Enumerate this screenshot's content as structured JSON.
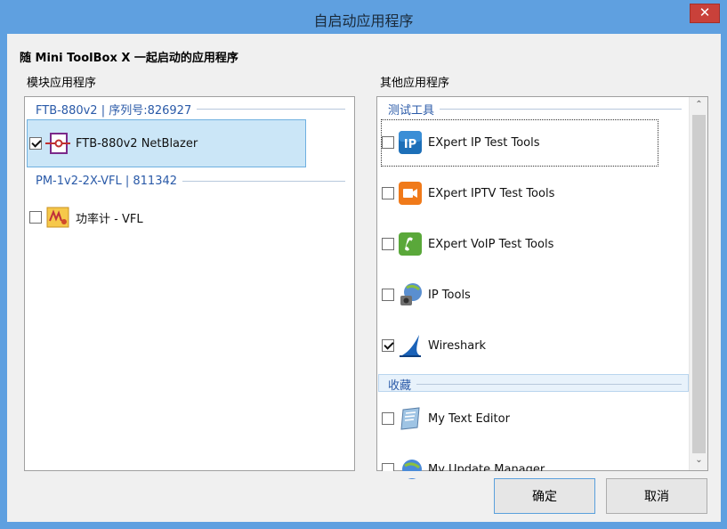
{
  "window": {
    "title": "自启动应用程序",
    "close_glyph": "✕"
  },
  "header_label": "随 Mini ToolBox X 一起启动的应用程序",
  "left": {
    "section_label": "模块应用程序",
    "groups": [
      {
        "header": "FTB-880v2 | 序列号:826927",
        "items": [
          {
            "label": "FTB-880v2 NetBlazer",
            "checked": true,
            "icon": "netblazer-icon"
          }
        ]
      },
      {
        "header": "PM-1v2-2X-VFL | 811342",
        "items": [
          {
            "label": "功率计 - VFL",
            "checked": false,
            "icon": "power-meter-icon"
          }
        ]
      }
    ]
  },
  "right": {
    "section_label": "其他应用程序",
    "groups": [
      {
        "header": "测试工具",
        "items": [
          {
            "label": "EXpert IP Test Tools",
            "checked": false,
            "icon": "expert-ip-icon"
          },
          {
            "label": "EXpert IPTV Test Tools",
            "checked": false,
            "icon": "expert-iptv-icon"
          },
          {
            "label": "EXpert VoIP Test Tools",
            "checked": false,
            "icon": "expert-voip-icon"
          },
          {
            "label": "IP Tools",
            "checked": false,
            "icon": "ip-tools-icon"
          },
          {
            "label": "Wireshark",
            "checked": true,
            "icon": "wireshark-icon"
          }
        ]
      },
      {
        "header": "收藏",
        "items": [
          {
            "label": "My Text Editor",
            "checked": false,
            "icon": "text-editor-icon"
          },
          {
            "label": "My Update Manager",
            "checked": false,
            "icon": "update-manager-icon"
          }
        ]
      }
    ],
    "scroll_up": "⌃",
    "scroll_down": "⌄"
  },
  "buttons": {
    "ok": "确定",
    "cancel": "取消"
  },
  "colors": {
    "titlebar": "#5fa0e0",
    "group_header_text": "#2a5aa8",
    "selection": "#cbe6f7"
  }
}
